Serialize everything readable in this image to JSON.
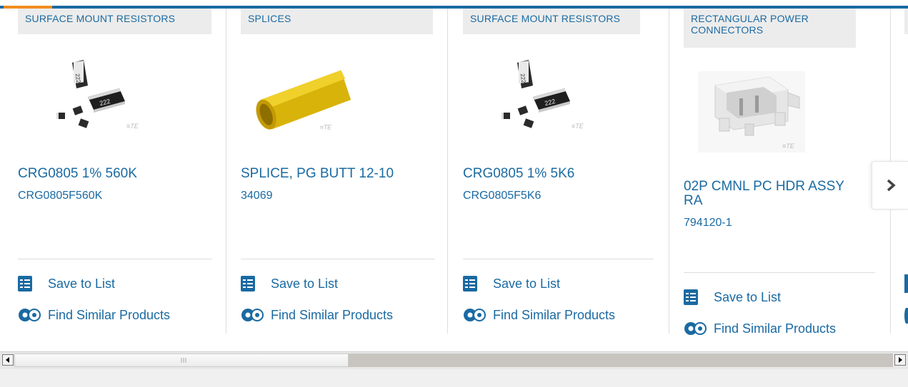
{
  "colors": {
    "link": "#1a6aa2",
    "accent_bar": "#f28c1e",
    "category_bg": "#ececec"
  },
  "products": [
    {
      "category": "SURFACE MOUNT RESISTORS",
      "name": "CRG0805 1% 560K",
      "part_number": "CRG0805F560K",
      "image": "resistor-chip-image",
      "save_label": "Save to List",
      "similar_label": "Find Similar Products"
    },
    {
      "category": "SPLICES",
      "name": "SPLICE, PG BUTT 12-10",
      "part_number": "34069",
      "image": "yellow-butt-splice-image",
      "save_label": "Save to List",
      "similar_label": "Find Similar Products"
    },
    {
      "category": "SURFACE MOUNT RESISTORS",
      "name": "CRG0805 1% 5K6",
      "part_number": "CRG0805F5K6",
      "image": "resistor-chip-image",
      "save_label": "Save to List",
      "similar_label": "Find Similar Products"
    },
    {
      "category": "RECTANGULAR POWER CONNECTORS",
      "name": "02P CMNL PC HDR ASSY RA",
      "part_number": "794120-1",
      "image": "white-header-connector-image",
      "save_label": "Save to List",
      "similar_label": "Find Similar Products"
    }
  ],
  "carousel": {
    "next_icon": "chevron-right-icon"
  },
  "scrollbar": {
    "left_icon": "scroll-left-arrow-icon",
    "right_icon": "scroll-right-arrow-icon",
    "position_fraction": 0.0
  }
}
